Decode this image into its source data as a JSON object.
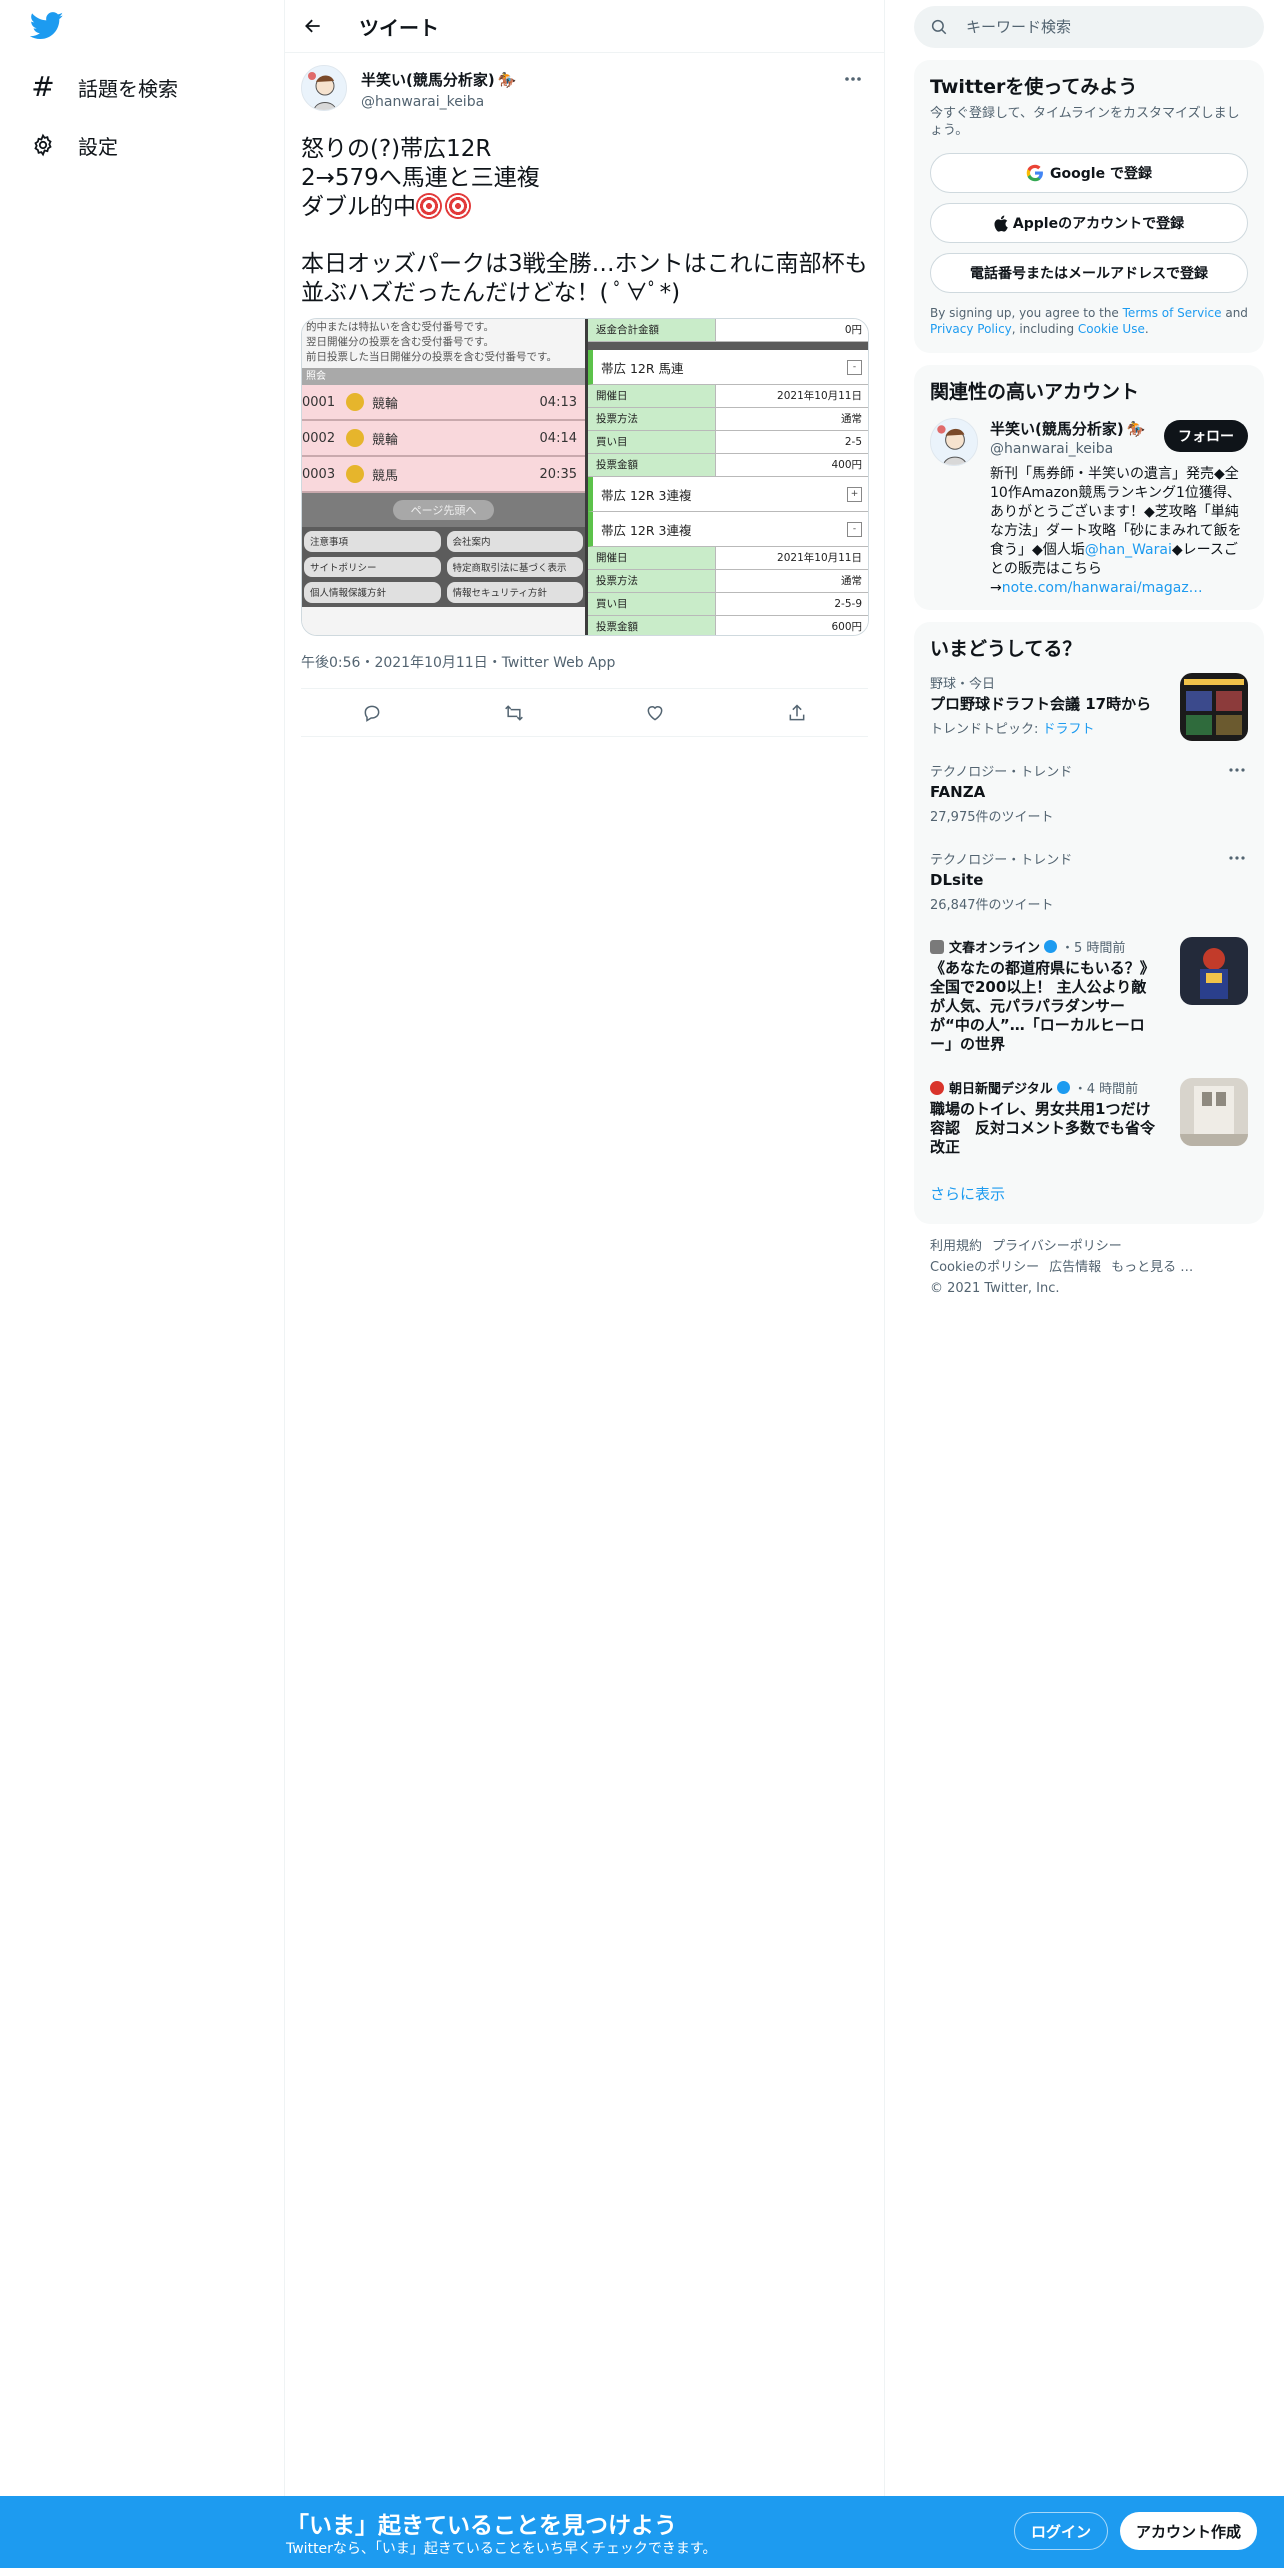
{
  "nav": {
    "items": [
      {
        "label": "話題を検索",
        "icon": "hashtag-icon"
      },
      {
        "label": "設定",
        "icon": "gear-icon"
      }
    ]
  },
  "header": {
    "title": "ツイート"
  },
  "tweet": {
    "author_name": "半笑い(競馬分析家)",
    "author_handle": "@hanwarai_keiba",
    "lines": [
      "怒りの(?)帯広12R",
      "2→579へ馬連と三連複",
      "ダブル的中"
    ],
    "line2_para": "本日オッズパークは3戦全勝…ホントはこれに南部杯も並ぶハズだったんだけどな！( ﾟ∀ﾟ*)",
    "timestamp": "午後0:56・2021年10月11日・Twitter Web App",
    "media": {
      "left_notes": [
        "的中または特払いを含む受付番号です。",
        "翌日開催分の投票を含む受付番号です。",
        "前日投票した当日開催分の投票を含む受付番号です。"
      ],
      "left_bar": "照会",
      "left_rows": [
        {
          "num": "0001",
          "kind": "競輪",
          "time": "04:13"
        },
        {
          "num": "0002",
          "kind": "競輪",
          "time": "04:14"
        },
        {
          "num": "0003",
          "kind": "競馬",
          "time": "20:35"
        }
      ],
      "pager": "ページ先頭へ",
      "footer_links": [
        "注意事項",
        "会社案内",
        "サイトポリシー",
        "特定商取引法に基づく表示",
        "個人情報保護方針",
        "情報セキュリティ方針"
      ],
      "right_top": {
        "k": "返金合計金額",
        "v": "0円"
      },
      "blocks": [
        {
          "head": "帯広 12R 馬連",
          "toggle": "-",
          "rows": [
            {
              "k": "開催日",
              "v": "2021年10月11日"
            },
            {
              "k": "投票方法",
              "v": "通常"
            },
            {
              "k": "買い目",
              "v": "2-5"
            },
            {
              "k": "投票金額",
              "v": "400円"
            }
          ]
        },
        {
          "head": "帯広 12R 3連複",
          "toggle": "+",
          "rows": []
        },
        {
          "head": "帯広 12R 3連複",
          "toggle": "-",
          "rows": [
            {
              "k": "開催日",
              "v": "2021年10月11日"
            },
            {
              "k": "投票方法",
              "v": "通常"
            },
            {
              "k": "買い目",
              "v": "2-5-9"
            },
            {
              "k": "投票金額",
              "v": "600円"
            }
          ]
        }
      ]
    }
  },
  "search": {
    "placeholder": "キーワード検索"
  },
  "signup": {
    "title": "Twitterを使ってみよう",
    "sub": "今すぐ登録して、タイムラインをカスタマイズしましょう。",
    "google": "Google で登録",
    "apple": "Appleのアカウントで登録",
    "phone": "電話番号またはメールアドレスで登録",
    "legal_1": "By signing up, you agree to the ",
    "terms": "Terms of Service",
    "legal_2": " and ",
    "privacy": "Privacy Policy",
    "legal_3": ", including ",
    "cookie": "Cookie Use",
    "legal_4": "."
  },
  "related": {
    "title": "関連性の高いアカウント",
    "name": "半笑い(競馬分析家)",
    "handle": "@hanwarai_keiba",
    "follow": "フォロー",
    "bio_1": "新刊「馬券師・半笑いの遺言」発売◆全10作Amazon競馬ランキング1位獲得、ありがとうございます！◆芝攻略「単純な方法」ダート攻略「砂にまみれて飯を食う」◆個人垢",
    "bio_link1": "@han_Warai",
    "bio_2": "◆レースごとの販売はこちら→",
    "bio_link2": "note.com/hanwarai/magaz…"
  },
  "trends": {
    "title": "いまどうしてる？",
    "items": [
      {
        "cat": "野球・今日",
        "title": "プロ野球ドラフト会議 17時から",
        "sub_prefix": "トレンドトピック: ",
        "sub_link": "ドラフト"
      },
      {
        "cat": "テクノロジー・トレンド",
        "title": "FANZA",
        "sub": "27,975件のツイート"
      },
      {
        "cat": "テクノロジー・トレンド",
        "title": "DLsite",
        "sub": "26,847件のツイート"
      },
      {
        "source": "文春オンライン",
        "time": "・5 時間前",
        "title": "《あなたの都道府県にもいる？》全国で200以上！ 主人公より敵が人気、元パラパラダンサーが“中の人”…「ローカルヒーロー」の世界"
      },
      {
        "source": "朝日新聞デジタル",
        "time": "・4 時間前",
        "title": "職場のトイレ、男女共用1つだけ容認　反対コメント多数でも省令改正"
      }
    ],
    "show_more": "さらに表示"
  },
  "footer": {
    "links": [
      "利用規約",
      "プライバシーポリシー",
      "Cookieのポリシー",
      "広告情報",
      "もっと見る …"
    ],
    "copyright": "© 2021 Twitter, Inc."
  },
  "bottom": {
    "title": "「いま」起きていることを見つけよう",
    "sub": "Twitterなら、「いま」起きていることをいち早くチェックできます。",
    "login": "ログイン",
    "signup": "アカウント作成"
  },
  "colors": {
    "accent": "#1d9bf0",
    "text": "#0f1419",
    "muted": "#536471",
    "dark_button": "#0f1419"
  }
}
